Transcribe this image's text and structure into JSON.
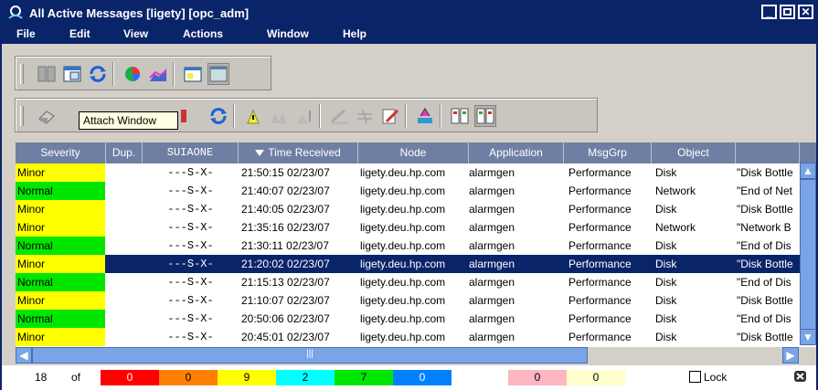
{
  "window": {
    "title": "All Active Messages [ligety] [opc_adm]"
  },
  "menu": [
    "File",
    "Edit",
    "View",
    "Actions",
    "Window",
    "Help"
  ],
  "tooltip": "Attach Window",
  "columns": [
    {
      "label": "Severity"
    },
    {
      "label": "Dup."
    },
    {
      "label": "SUIAONE"
    },
    {
      "label": "Time Received",
      "sorted": true
    },
    {
      "label": "Node"
    },
    {
      "label": "Application"
    },
    {
      "label": "MsgGrp"
    },
    {
      "label": "Object"
    },
    {
      "label": ""
    }
  ],
  "rows": [
    {
      "severity": "Minor",
      "sev_color": "#ffff00",
      "dup": "",
      "flags": "---S-X-",
      "time": "21:50:15 02/23/07",
      "node": "ligety.deu.hp.com",
      "app": "alarmgen",
      "msggrp": "Performance",
      "object": "Disk",
      "text": "\"Disk Bottle"
    },
    {
      "severity": "Normal",
      "sev_color": "#00e600",
      "dup": "",
      "flags": "---S-X-",
      "time": "21:40:07 02/23/07",
      "node": "ligety.deu.hp.com",
      "app": "alarmgen",
      "msggrp": "Performance",
      "object": "Network",
      "text": "\"End of Net"
    },
    {
      "severity": "Minor",
      "sev_color": "#ffff00",
      "dup": "",
      "flags": "---S-X-",
      "time": "21:40:05 02/23/07",
      "node": "ligety.deu.hp.com",
      "app": "alarmgen",
      "msggrp": "Performance",
      "object": "Disk",
      "text": "\"Disk Bottle"
    },
    {
      "severity": "Minor",
      "sev_color": "#ffff00",
      "dup": "",
      "flags": "---S-X-",
      "time": "21:35:16 02/23/07",
      "node": "ligety.deu.hp.com",
      "app": "alarmgen",
      "msggrp": "Performance",
      "object": "Network",
      "text": "\"Network B"
    },
    {
      "severity": "Normal",
      "sev_color": "#00e600",
      "dup": "",
      "flags": "---S-X-",
      "time": "21:30:11 02/23/07",
      "node": "ligety.deu.hp.com",
      "app": "alarmgen",
      "msggrp": "Performance",
      "object": "Disk",
      "text": "\"End of Dis"
    },
    {
      "severity": "Minor",
      "sev_color": "#ffff00",
      "dup": "",
      "flags": "---S-X-",
      "time": "21:20:02 02/23/07",
      "node": "ligety.deu.hp.com",
      "app": "alarmgen",
      "msggrp": "Performance",
      "object": "Disk",
      "text": "\"Disk Bottle",
      "selected": true
    },
    {
      "severity": "Normal",
      "sev_color": "#00e600",
      "dup": "",
      "flags": "---S-X-",
      "time": "21:15:13 02/23/07",
      "node": "ligety.deu.hp.com",
      "app": "alarmgen",
      "msggrp": "Performance",
      "object": "Disk",
      "text": "\"End of Dis"
    },
    {
      "severity": "Minor",
      "sev_color": "#ffff00",
      "dup": "",
      "flags": "---S-X-",
      "time": "21:10:07 02/23/07",
      "node": "ligety.deu.hp.com",
      "app": "alarmgen",
      "msggrp": "Performance",
      "object": "Disk",
      "text": "\"Disk Bottle"
    },
    {
      "severity": "Normal",
      "sev_color": "#00e600",
      "dup": "",
      "flags": "---S-X-",
      "time": "20:50:06 02/23/07",
      "node": "ligety.deu.hp.com",
      "app": "alarmgen",
      "msggrp": "Performance",
      "object": "Disk",
      "text": "\"End of Dis"
    },
    {
      "severity": "Minor",
      "sev_color": "#ffff00",
      "dup": "",
      "flags": "---S-X-",
      "time": "20:45:01 02/23/07",
      "node": "ligety.deu.hp.com",
      "app": "alarmgen",
      "msggrp": "Performance",
      "object": "Disk",
      "text": "\"Disk Bottle"
    }
  ],
  "status": {
    "total": "18",
    "of_label": "of",
    "counts": [
      {
        "value": "0",
        "color": "#ff0000",
        "text_color": "#ffffff"
      },
      {
        "value": "0",
        "color": "#ff8000",
        "text_color": "#000000"
      },
      {
        "value": "9",
        "color": "#ffff00",
        "text_color": "#000000"
      },
      {
        "value": "2",
        "color": "#00ffff",
        "text_color": "#000000"
      },
      {
        "value": "7",
        "color": "#00e600",
        "text_color": "#000000"
      },
      {
        "value": "0",
        "color": "#0080ff",
        "text_color": "#ffffff"
      },
      {
        "value": "0",
        "color": "#ffb6c1",
        "text_color": "#000000"
      },
      {
        "value": "0",
        "color": "#ffffcc",
        "text_color": "#000000"
      }
    ],
    "lock_label": "Lock"
  },
  "icons": {
    "window": "openview-logo-icon",
    "close_panel": "close-panel-icon"
  }
}
